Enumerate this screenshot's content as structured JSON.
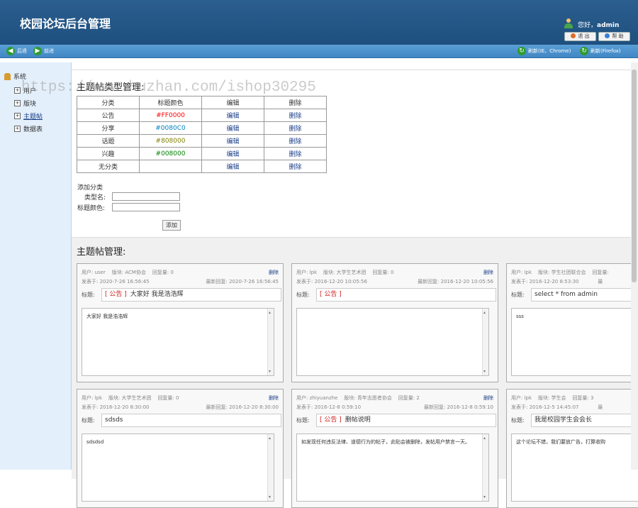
{
  "header": {
    "title": "校园论坛后台管理",
    "greeting": "您好，",
    "username": "admin",
    "logout_label": "退 出",
    "help_label": "帮 助"
  },
  "toolbar": {
    "back_label": "后退",
    "forward_label": "前进",
    "refresh_ie_label": "刷新(IE、Chrome)",
    "refresh_ff_label": "刷新(Firefox)"
  },
  "sidebar": {
    "root_label": "系统",
    "items": [
      "用户",
      "版块",
      "主题帖",
      "数据表"
    ]
  },
  "watermark": "https://www.huzhan.com/ishop30295",
  "categories": {
    "title": "主题帖类型管理:",
    "headers": [
      "分类",
      "标题颜色",
      "编辑",
      "删除"
    ],
    "rows": [
      {
        "name": "公告",
        "color": "#FF0000",
        "edit": "编辑",
        "del": "删除"
      },
      {
        "name": "分享",
        "color": "#0080C0",
        "edit": "编辑",
        "del": "删除"
      },
      {
        "name": "话题",
        "color": "#808000",
        "edit": "编辑",
        "del": "删除"
      },
      {
        "name": "兴趣",
        "color": "#008000",
        "edit": "编辑",
        "del": "删除"
      },
      {
        "name": "无分类",
        "color": "",
        "edit": "编辑",
        "del": "删除"
      }
    ],
    "add_title": "添加分类",
    "type_name_label": "类型名:",
    "title_color_label": "标题颜色:",
    "add_button": "添加"
  },
  "posts": {
    "title": "主题帖管理:",
    "items": [
      {
        "user": "用户:  user",
        "board": "版块:  ACM协会",
        "replies": "回复量:  0",
        "del": "删除",
        "posted": "发表于:  2020-7-26 16:56:45",
        "last": "最新回复:  2020-7-26 16:56:45",
        "title_label": "标题:",
        "category": "[ 公告 ]",
        "subject": "大家好 我是浩浩辉",
        "content": "大家好 我是浩浩辉"
      },
      {
        "user": "用户:  lpk",
        "board": "版块:  大学生艺术团",
        "replies": "回复量:  0",
        "del": "删除",
        "posted": "发表于:  2016-12-20 10:05:56",
        "last": "最新回复:  2016-12-20 10:05:56",
        "title_label": "标题:",
        "category": "[ 公告 ]",
        "subject": "",
        "content": ""
      },
      {
        "user": "用户:  lpk",
        "board": "版块:  学生社团联合会",
        "replies": "回复量:",
        "del": "",
        "posted": "发表于:  2016-12-20 8:53:30",
        "last": "最",
        "title_label": "标题:",
        "category": "",
        "subject": "select * from admin",
        "content": "sss"
      },
      {
        "user": "用户:  lpk",
        "board": "版块:  大学生艺术团",
        "replies": "回复量:  0",
        "del": "删除",
        "posted": "发表于:  2016-12-20 8:30:00",
        "last": "最新回复:  2016-12-20 8:30:00",
        "title_label": "标题:",
        "category": "",
        "subject": "sdsds",
        "content": "sdsdsd"
      },
      {
        "user": "用户:  zhiyuanzhe",
        "board": "版块:  青年志愿者协会",
        "replies": "回复量:  2",
        "del": "删除",
        "posted": "发表于:  2016-12-8 0:59:10",
        "last": "最新回复:  2016-12-8 0:59:10",
        "title_label": "标题:",
        "category": "[ 公告 ]",
        "subject": "删帖说明",
        "content": "如发现任何违反法律、道德行为的帖子，此贴会被删除，发帖用户禁言一天。"
      },
      {
        "user": "用户:  lpk",
        "board": "版块:  学生会",
        "replies": "回复量:  3",
        "del": "",
        "posted": "发表于:  2016-12-5 14:45:07",
        "last": "最",
        "title_label": "标题:",
        "category": "",
        "subject": "我是校园学生会会长",
        "content": "这个论坛不错，我们要放广告，打算收购"
      }
    ]
  }
}
